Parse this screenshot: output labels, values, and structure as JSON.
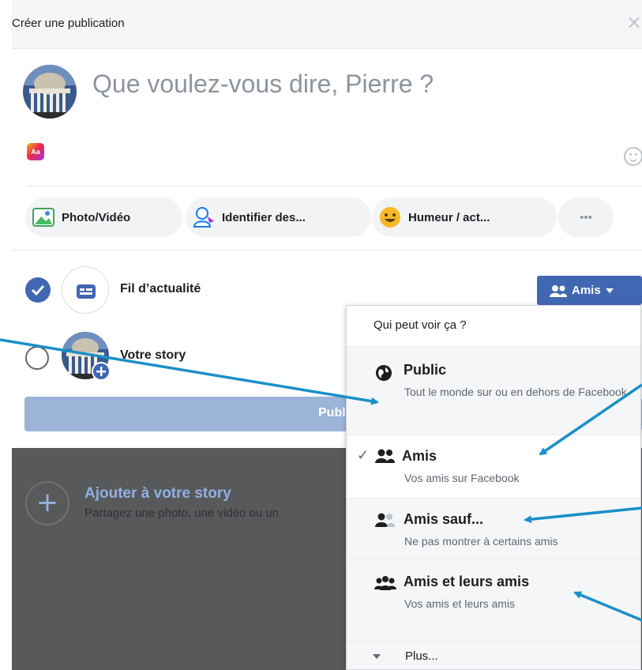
{
  "header": {
    "title": "Créer une publication",
    "close_glyph": "×"
  },
  "composer": {
    "placeholder": "Que voulez-vous dire, Pierre ?"
  },
  "text_format_icon": "Aa",
  "actions": [
    {
      "label": "Photo/Vidéo",
      "icon": "photo-icon"
    },
    {
      "label": "Identifier des...",
      "icon": "tag-people-icon"
    },
    {
      "label": "Humeur / act...",
      "icon": "feeling-icon"
    },
    {
      "label": "•••",
      "icon": "more-icon"
    }
  ],
  "destinations": {
    "feed": {
      "label": "Fil d’actualité",
      "checked": true
    },
    "story": {
      "label": "Votre story",
      "checked": false
    }
  },
  "audience_button": {
    "label": "Amis"
  },
  "publish": {
    "label": "Publier"
  },
  "story_panel": {
    "title": "Ajouter à votre story",
    "subtitle": "Partagez une photo, une vidéo ou un"
  },
  "audience_menu": {
    "header": "Qui peut voir ça ?",
    "options": [
      {
        "title": "Public",
        "description": "Tout le monde sur ou en dehors de Facebook",
        "icon": "globe-icon",
        "selected": false
      },
      {
        "title": "Amis",
        "description": "Vos amis sur Facebook",
        "icon": "friends-icon",
        "selected": true
      },
      {
        "title": "Amis sauf...",
        "description": "Ne pas montrer à certains amis",
        "icon": "friends-except-icon",
        "selected": false
      },
      {
        "title": "Amis et leurs amis",
        "description": "Vos amis et leurs amis",
        "icon": "friends-of-friends-icon",
        "selected": false
      }
    ],
    "more": "Plus..."
  },
  "colors": {
    "accent": "#4267b2",
    "annotation_arrow": "#1a8fc9",
    "overlay": "#58595b"
  }
}
